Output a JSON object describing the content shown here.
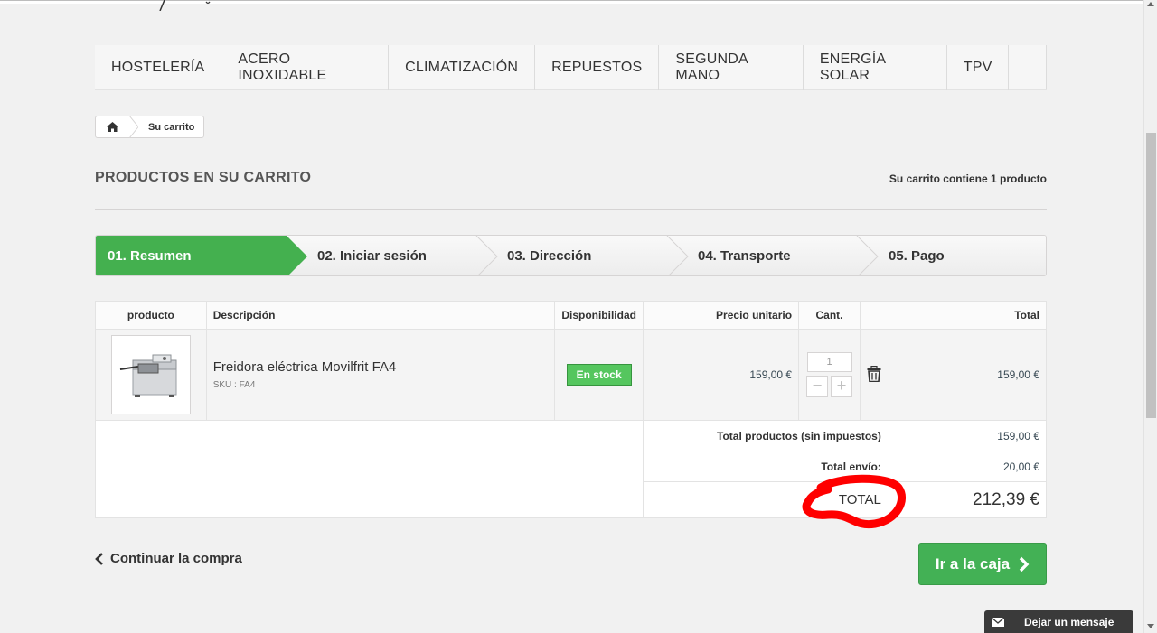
{
  "nav": {
    "items": [
      "HOSTELERÍA",
      "ACERO INOXIDABLE",
      "CLIMATIZACIÓN",
      "REPUESTOS",
      "SEGUNDA MANO",
      "ENERGÍA SOLAR",
      "TPV"
    ]
  },
  "breadcrumb": {
    "current": "Su carrito"
  },
  "page": {
    "heading": "PRODUCTOS EN SU CARRITO",
    "summary_prefix": "Su carrito contiene",
    "summary_count": "1",
    "summary_suffix": "producto"
  },
  "steps": [
    "01. Resumen",
    "02. Iniciar sesión",
    "03. Dirección",
    "04. Transporte",
    "05. Pago"
  ],
  "table": {
    "headers": {
      "product": "producto",
      "description": "Descripción",
      "availability": "Disponibilidad",
      "unit_price": "Precio unitario",
      "qty": "Cant.",
      "total": "Total"
    },
    "items": [
      {
        "name": "Freidora eléctrica Movilfrit FA4",
        "sku": "SKU : FA4",
        "availability": "En stock",
        "unit_price": "159,00 €",
        "qty": "1",
        "total": "159,00 €"
      }
    ],
    "totals": {
      "products_label": "Total productos (sin impuestos)",
      "products_value": "159,00 €",
      "shipping_label": "Total envío:",
      "shipping_value": "20,00 €",
      "grand_label": "TOTAL",
      "grand_value": "212,39 €"
    }
  },
  "actions": {
    "continue": "Continuar la compra",
    "checkout": "Ir a la caja"
  },
  "chat": {
    "label": "Dejar un mensaje"
  },
  "colors": {
    "accent_green": "#43b155",
    "annotation_red": "#ff0000"
  }
}
